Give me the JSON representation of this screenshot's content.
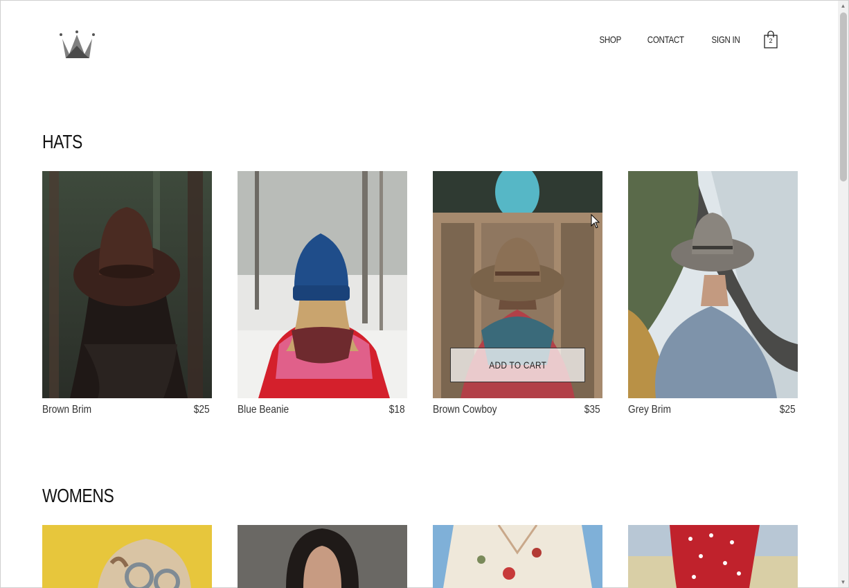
{
  "nav": {
    "logo_icon": "crown-icon",
    "links": [
      {
        "label": "SHOP"
      },
      {
        "label": "CONTACT"
      },
      {
        "label": "SIGN IN"
      }
    ],
    "cart_icon": "shopping-bag-icon",
    "cart_count": "2"
  },
  "sections": {
    "hats": {
      "title": "HATS",
      "items": [
        {
          "name": "Brown Brim",
          "price": "$25"
        },
        {
          "name": "Blue Beanie",
          "price": "$18"
        },
        {
          "name": "Brown Cowboy",
          "price": "$35",
          "button": "ADD TO CART"
        },
        {
          "name": "Grey Brim",
          "price": "$25"
        }
      ]
    },
    "womens": {
      "title": "WOMENS"
    }
  },
  "colors": {
    "text": "#222222",
    "logo": "#555555",
    "scrollbar_thumb": "#c1c1c1"
  }
}
